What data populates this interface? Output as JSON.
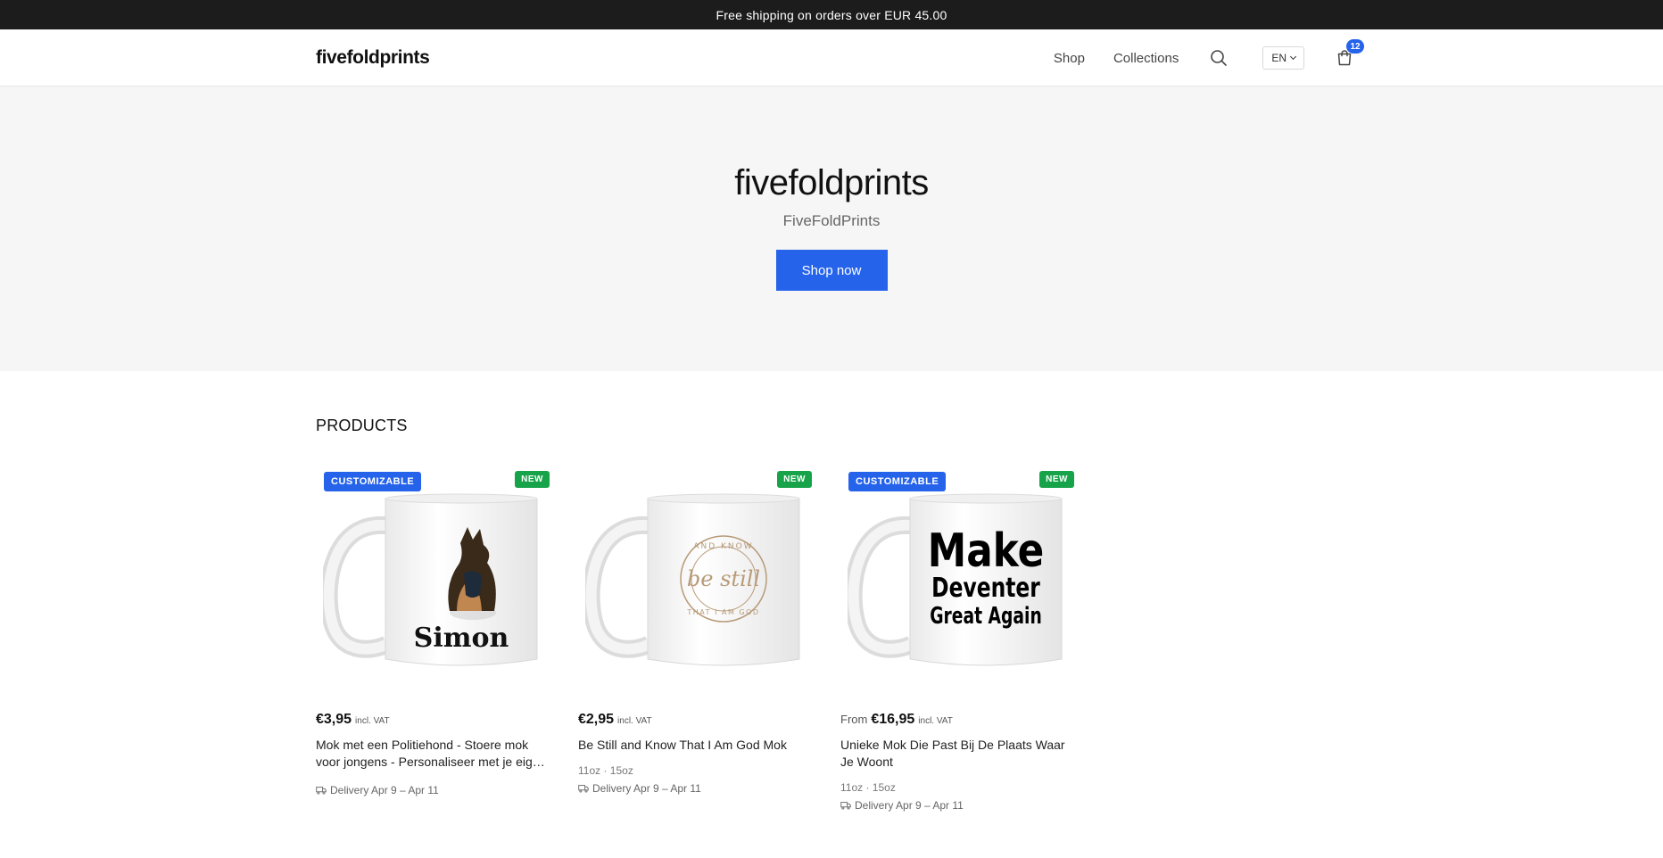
{
  "announcement": "Free shipping on orders over EUR 45.00",
  "header": {
    "logo": "fivefoldprints",
    "nav": [
      {
        "label": "Shop"
      },
      {
        "label": "Collections"
      }
    ],
    "search_icon": "search-icon",
    "language": "EN",
    "cart_icon": "shopping-bag-icon",
    "cart_count": "12"
  },
  "hero": {
    "title": "fivefoldprints",
    "subtitle": "FiveFoldPrints",
    "cta": "Shop now"
  },
  "products_section": {
    "title": "PRODUCTS",
    "items": [
      {
        "badge_customizable": "CUSTOMIZABLE",
        "badge_new": "NEW",
        "price_from": "",
        "price": "€3,95",
        "vat": "incl. VAT",
        "title": "Mok met een Politiehond - Stoere mok voor jongens - Personaliseer met je eigen naam",
        "variants": "",
        "delivery": "Delivery Apr 9 – Apr 11",
        "mug_text": "Simon"
      },
      {
        "badge_customizable": "",
        "badge_new": "NEW",
        "price_from": "",
        "price": "€2,95",
        "vat": "incl. VAT",
        "title": "Be Still and Know That I Am God Mok",
        "variants": "11oz · 15oz",
        "delivery": "Delivery Apr 9 – Apr 11",
        "mug_text": "be still",
        "mug_ring_top": "AND KNOW",
        "mug_ring_bottom": "THAT I AM GOD"
      },
      {
        "badge_customizable": "CUSTOMIZABLE",
        "badge_new": "NEW",
        "price_from": "From",
        "price": "€16,95",
        "vat": "incl. VAT",
        "title": "Unieke Mok Die Past Bij De Plaats Waar Je Woont",
        "variants": "11oz · 15oz",
        "delivery": "Delivery Apr 9 – Apr 11",
        "mug_lines": [
          "Make",
          "Deventer",
          "Great Again"
        ]
      }
    ]
  },
  "colors": {
    "accent": "#2563eb",
    "new_badge": "#16a34a",
    "announcement_bg": "#1c1c1c",
    "hero_bg": "#f6f6f6"
  }
}
